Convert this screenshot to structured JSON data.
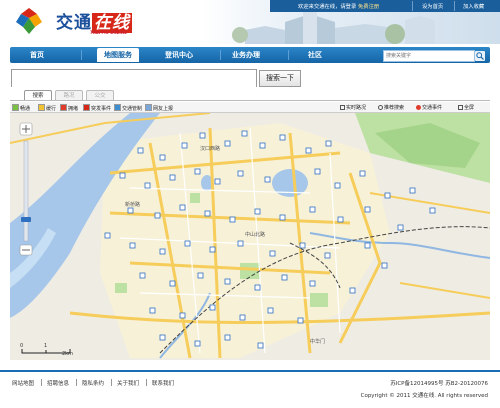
{
  "logo": {
    "main_a": "交通",
    "main_b": "在线",
    "sub": "TRAFFIC ONLINE"
  },
  "topbar": {
    "welcome": "欢迎来交通在线，请登录",
    "register": "免费注册",
    "homepage": "设为首页",
    "favorite": "加入收藏"
  },
  "nav": {
    "items": [
      "首页",
      "地图服务",
      "登讯中心",
      "业务办理",
      "社区"
    ],
    "search_placeholder": "搜索关键字"
  },
  "search": {
    "input_value": "",
    "button": "搜索一下"
  },
  "tabs": [
    "搜索",
    "路况",
    "公交"
  ],
  "legend": {
    "items": [
      {
        "label": "畅通",
        "color": "#7ac143"
      },
      {
        "label": "缓行",
        "color": "#f1c232"
      },
      {
        "label": "拥堵",
        "color": "#e03b2b"
      },
      {
        "label": "突发事件",
        "color": "#d62718"
      },
      {
        "label": "交通管制",
        "color": "#3e8ed0"
      },
      {
        "label": "网友上报",
        "color": "#7aa6d8"
      }
    ],
    "right": [
      "实时路况",
      "推荐搜索",
      "交通事件",
      "全屏"
    ]
  },
  "map": {
    "scale_label": "2km",
    "scale_zero": "0",
    "scale_one": "1",
    "places": [
      "汉口西路",
      "汉口路",
      "新桥路",
      "中山北路",
      "中华门",
      "大桥"
    ]
  },
  "footer": {
    "links": [
      "网站地图",
      "招聘信息",
      "隐私条约",
      "关于我们",
      "联系我们"
    ],
    "icp": "苏ICP备12014995号  苏B2-20120076",
    "copyright": "Copyright © 2011 交通在线. All rights reserved"
  }
}
